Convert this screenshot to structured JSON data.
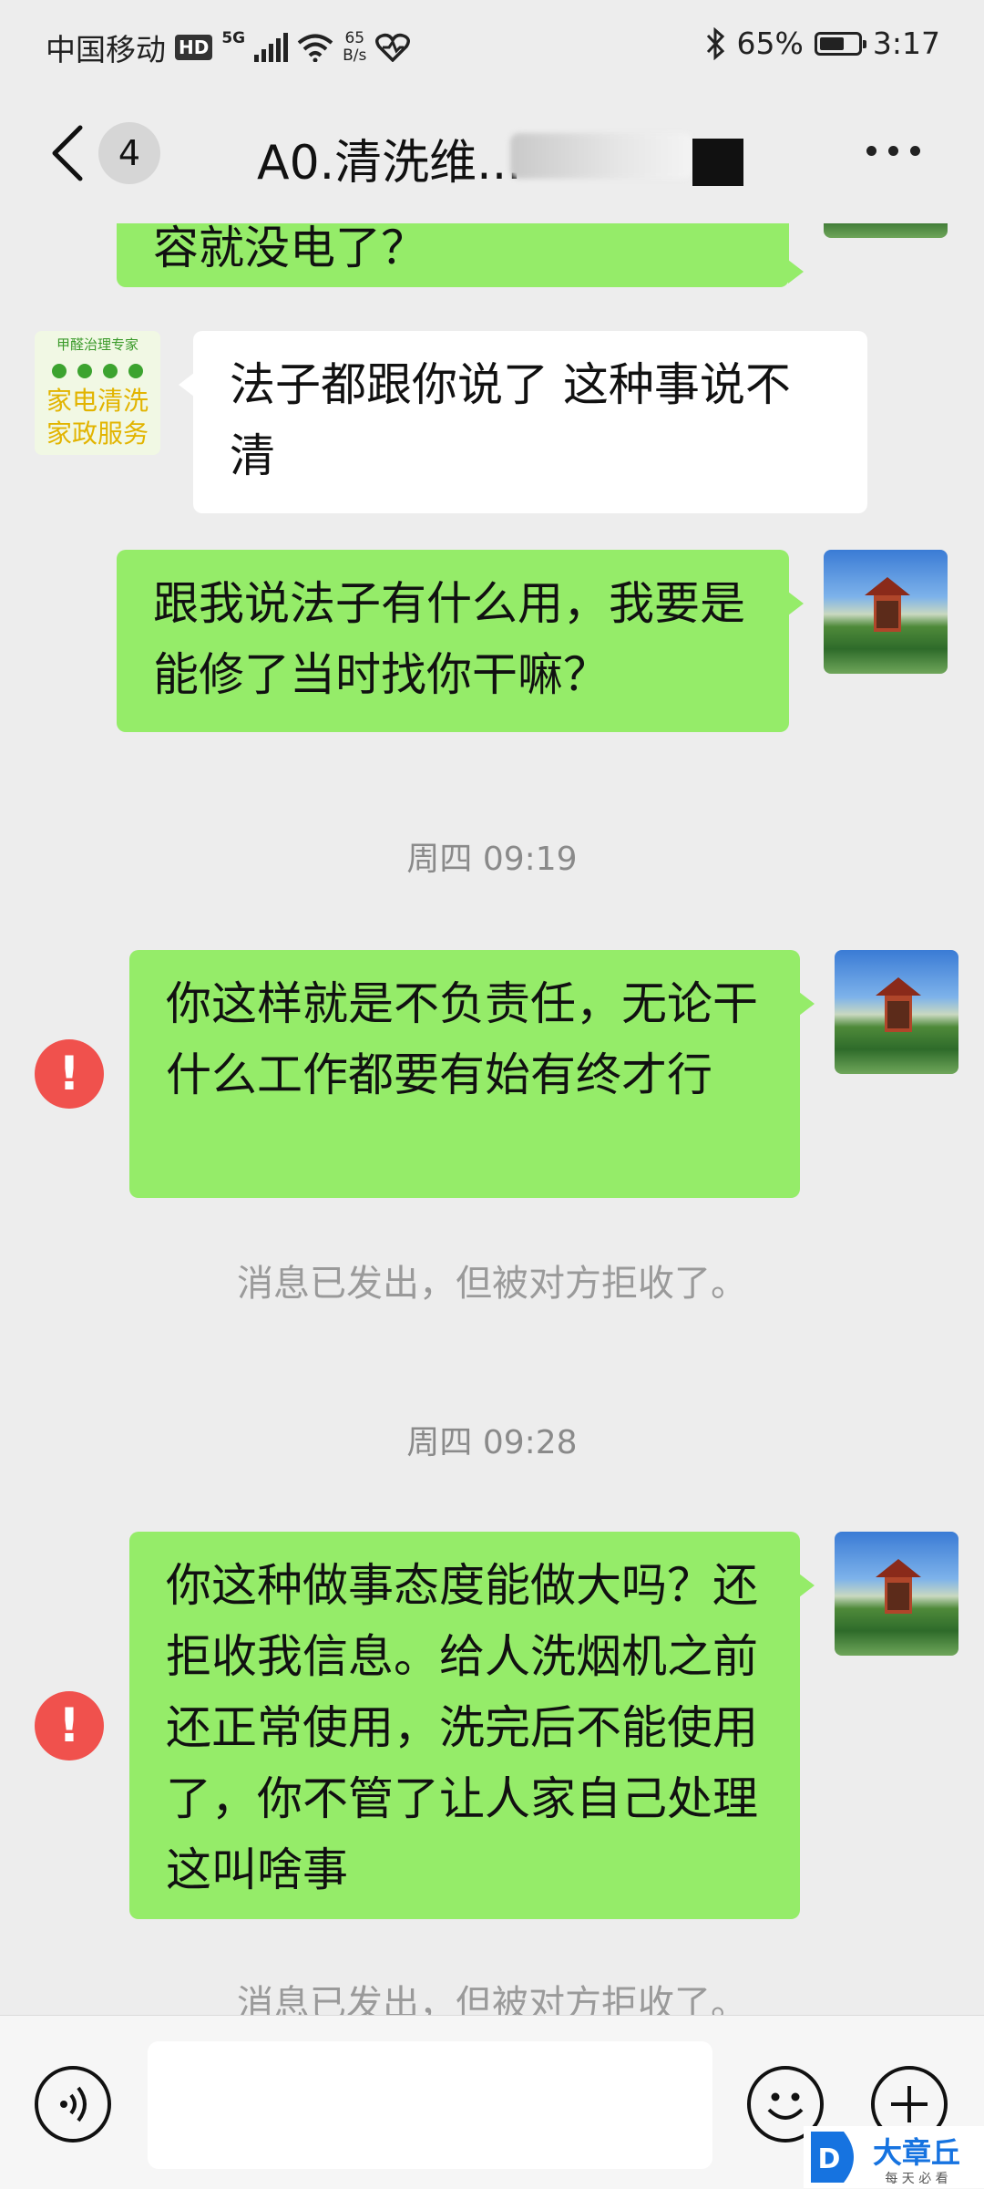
{
  "status_bar": {
    "carrier": "中国移动",
    "hd_badge": "HD",
    "network_tag": "5G",
    "speed_value": "65",
    "speed_unit": "B/s",
    "battery_percent": "65%",
    "battery_level": 0.65,
    "time": "3:17"
  },
  "nav": {
    "unread_count": "4",
    "title": "A0.清洗维..."
  },
  "messages": {
    "m1": "容就没电了？",
    "m2": "法子都跟你说了  这种事说不清",
    "contact_avatar": {
      "line1": "甲醛治理专家",
      "line2": "家电清洗",
      "line3": "家政服务"
    },
    "m3": "跟我说法子有什么用，我要是能修了当时找你干嘛？",
    "time1": "周四 09:19",
    "m4": "你这样就是不负责任，无论干什么工作都要有始有终才行",
    "error_mark": "!",
    "rejected1": "消息已发出，但被对方拒收了。",
    "time2": "周四 09:28",
    "m5": "你这种做事态度能做大吗？还拒收我信息。给人洗烟机之前还正常使用，洗完后不能使用了，你不管了让人家自己处理这叫啥事",
    "rejected2": "消息已发出，但被对方拒收了。"
  },
  "watermark": {
    "brand": "大章丘",
    "slogan": "每 天 必 看"
  },
  "colors": {
    "my_bubble": "#95ec69",
    "their_bubble": "#ffffff",
    "error": "#f0514d",
    "background": "#ededed"
  }
}
